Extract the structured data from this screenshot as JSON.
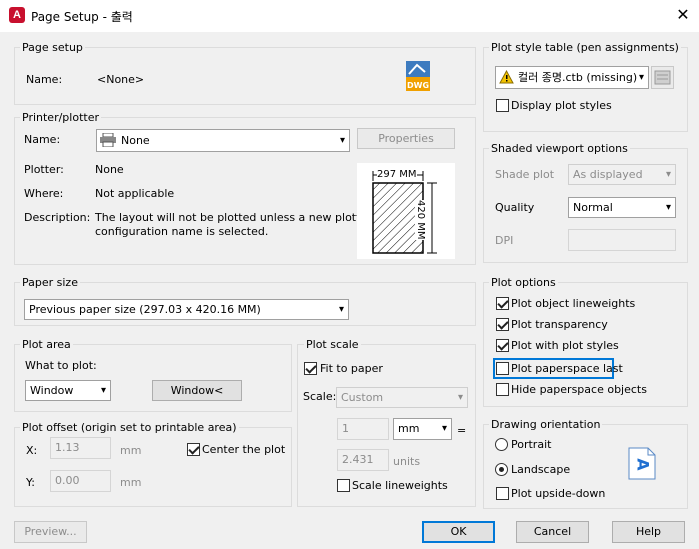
{
  "window": {
    "app_icon": "A",
    "title": "Page Setup - 출력",
    "close_glyph": "✕"
  },
  "page_setup": {
    "group": "Page setup",
    "name_label": "Name:",
    "name_value": "<None>",
    "dwg_icon_text": "DWG"
  },
  "printer": {
    "group": "Printer/plotter",
    "name_label": "Name:",
    "name_value": "None",
    "properties_button": "Properties",
    "plotter_label": "Plotter:",
    "plotter_value": "None",
    "where_label": "Where:",
    "where_value": "Not applicable",
    "description_label": "Description:",
    "description_line1": "The layout will not be plotted unless a new plotter",
    "description_line2": "configuration name is selected.",
    "preview": {
      "width_text": "297 MM",
      "height_text": "420 MM"
    }
  },
  "paper_size": {
    "group": "Paper size",
    "value": "Previous paper size (297.03 x 420.16 MM)"
  },
  "plot_area": {
    "group": "Plot area",
    "what_label": "What to plot:",
    "what_value": "Window",
    "window_button": "Window<"
  },
  "plot_offset": {
    "group": "Plot offset (origin set to printable area)",
    "x_label": "X:",
    "x_value": "1.13",
    "x_unit": "mm",
    "y_label": "Y:",
    "y_value": "0.00",
    "y_unit": "mm",
    "center_label": "Center the plot",
    "center_checked": true
  },
  "plot_scale": {
    "group": "Plot scale",
    "fit_label": "Fit to paper",
    "fit_checked": true,
    "scale_label": "Scale:",
    "scale_value": "Custom",
    "num_value": "1",
    "unit_value": "mm",
    "equals": "=",
    "units_value": "2.431",
    "units_label": "units",
    "lineweights_label": "Scale lineweights",
    "lineweights_checked": false
  },
  "plot_style": {
    "group": "Plot style table (pen assignments)",
    "table_value": "컬러 종명.ctb (missing)",
    "display_label": "Display plot styles",
    "display_checked": false
  },
  "shaded": {
    "group": "Shaded viewport options",
    "shade_label": "Shade plot",
    "shade_value": "As displayed",
    "quality_label": "Quality",
    "quality_value": "Normal",
    "dpi_label": "DPI",
    "dpi_value": ""
  },
  "plot_options": {
    "group": "Plot options",
    "items": [
      {
        "label": "Plot object lineweights",
        "checked": true
      },
      {
        "label": "Plot transparency",
        "checked": true
      },
      {
        "label": "Plot with plot styles",
        "checked": true
      },
      {
        "label": "Plot paperspace last",
        "checked": false
      },
      {
        "label": "Hide paperspace objects",
        "checked": false
      }
    ]
  },
  "orientation": {
    "group": "Drawing orientation",
    "portrait_label": "Portrait",
    "landscape_label": "Landscape",
    "selected": "landscape",
    "upside_label": "Plot upside-down",
    "upside_checked": false,
    "icon_letter": "A"
  },
  "footer": {
    "preview_button": "Preview...",
    "ok_button": "OK",
    "cancel_button": "Cancel",
    "help_button": "Help"
  },
  "colors": {
    "accent": "#0078d7",
    "app_red": "#c8102e",
    "warning": "#f2c200"
  }
}
